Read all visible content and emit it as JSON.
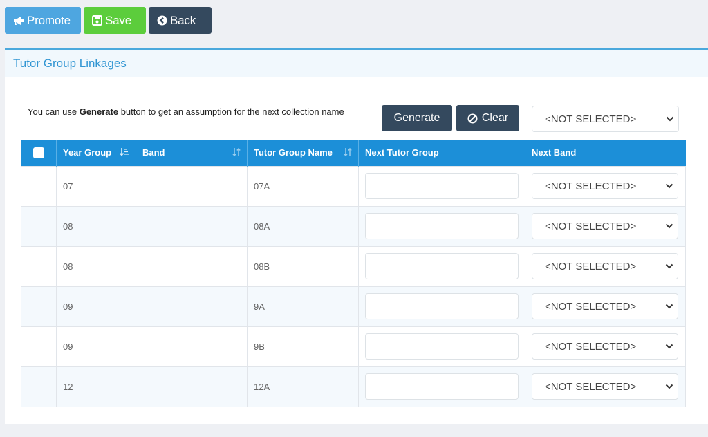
{
  "toolbar": {
    "promote_label": "Promote",
    "save_label": "Save",
    "back_label": "Back"
  },
  "panel": {
    "title": "Tutor Group Linkages",
    "info_prefix": "You can use ",
    "info_bold": "Generate",
    "info_suffix": " button to get an assumption for the next collection name",
    "generate_label": "Generate",
    "clear_label": "Clear",
    "band_filter_value": "<NOT SELECTED>"
  },
  "table": {
    "headers": [
      "Year Group",
      "Band",
      "Tutor Group Name",
      "Next Tutor Group",
      "Next Band"
    ],
    "rows": [
      {
        "year": "07",
        "band": "",
        "tutor_group": "07A",
        "next_tutor_group": "",
        "next_band": "<NOT SELECTED>"
      },
      {
        "year": "08",
        "band": "",
        "tutor_group": "08A",
        "next_tutor_group": "",
        "next_band": "<NOT SELECTED>"
      },
      {
        "year": "08",
        "band": "",
        "tutor_group": "08B",
        "next_tutor_group": "",
        "next_band": "<NOT SELECTED>"
      },
      {
        "year": "09",
        "band": "",
        "tutor_group": "9A",
        "next_tutor_group": "",
        "next_band": "<NOT SELECTED>"
      },
      {
        "year": "09",
        "band": "",
        "tutor_group": "9B",
        "next_tutor_group": "",
        "next_band": "<NOT SELECTED>"
      },
      {
        "year": "12",
        "band": "",
        "tutor_group": "12A",
        "next_tutor_group": "",
        "next_band": "<NOT SELECTED>"
      }
    ]
  },
  "icons": {
    "promote": "megaphone-icon",
    "save": "floppy-disk-icon",
    "back": "circle-chevron-left-icon",
    "clear": "ban-icon",
    "sort_active": "sort-amount-down-icon",
    "sort": "sort-icon",
    "dropdown": "chevron-down-icon"
  },
  "colors": {
    "promote": "#4ea6e0",
    "save": "#5ccd3c",
    "dark": "#34495e",
    "header": "#1c8fd8",
    "title": "#3296d3"
  }
}
